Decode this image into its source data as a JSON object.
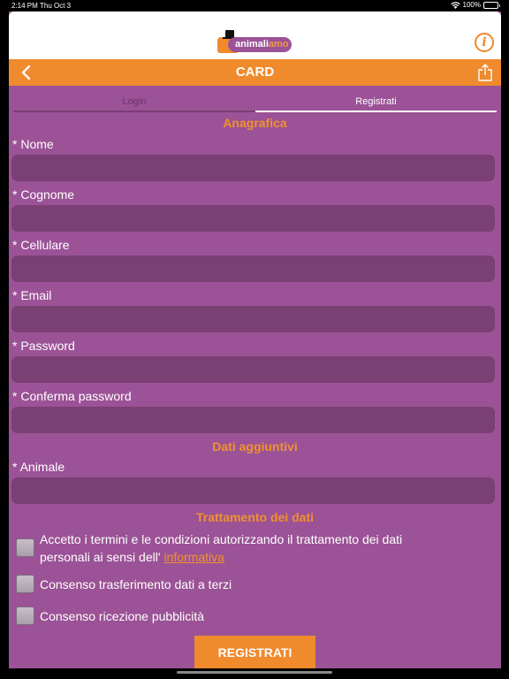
{
  "status_bar": {
    "time": "2:14 PM",
    "date": "Thu Oct 3",
    "battery": "100%"
  },
  "logo": {
    "part1": "animali",
    "part2": "amo"
  },
  "nav": {
    "title": "CARD"
  },
  "tabs": [
    {
      "label": "Login"
    },
    {
      "label": "Registrati"
    }
  ],
  "sections": {
    "anagrafica": "Anagrafica",
    "dati_aggiuntivi": "Dati aggiuntivi",
    "trattamento": "Trattamento dei dati"
  },
  "fields": [
    {
      "label": "* Nome",
      "value": ""
    },
    {
      "label": "* Cognome",
      "value": ""
    },
    {
      "label": "* Cellulare",
      "value": ""
    },
    {
      "label": "* Email",
      "value": ""
    },
    {
      "label": "* Password",
      "value": ""
    },
    {
      "label": "* Conferma password",
      "value": ""
    },
    {
      "label": "* Animale",
      "value": ""
    }
  ],
  "consents": {
    "terms_line1": "Accetto i termini e le condizioni autorizzando il trattamento dei dati",
    "terms_line2": "personali ai sensi dell'",
    "terms_link": "informativa",
    "third_party": "Consenso trasferimento dati a terzi",
    "advertising": "Consenso ricezione pubblicità"
  },
  "register_button": "REGISTRATI",
  "colors": {
    "purple": "#9b5296",
    "orange": "#ef8a2d",
    "input_bg": "#7a3f73"
  }
}
